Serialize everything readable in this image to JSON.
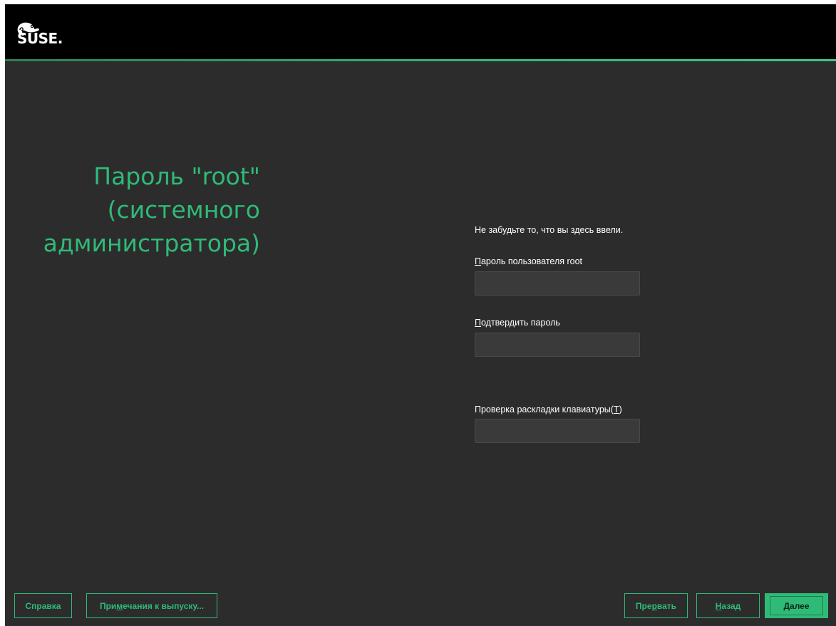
{
  "brand": {
    "logo_text": "SUSE.",
    "accent": "#30ba78"
  },
  "title": "Пароль \"root\"\n(системного\nадминистратора)",
  "hint": "Не забудьте то, что вы здесь ввели.",
  "fields": {
    "root_password": {
      "mnemonic": "П",
      "label_rest": "ароль пользователя root",
      "value": ""
    },
    "confirm_password": {
      "mnemonic": "П",
      "label_rest": "одтвердить пароль",
      "value": ""
    },
    "keyboard_test": {
      "label_pre": "Проверка раскладки клавиатуры(",
      "mnemonic": "T",
      "label_post": ")",
      "value": ""
    }
  },
  "buttons": {
    "help": "Справка",
    "notes_pre": "При",
    "notes_mn": "м",
    "notes_post": "ечания к выпуску...",
    "abort_pre": "Пре",
    "abort_mn": "р",
    "abort_post": "вать",
    "back_mn": "Н",
    "back_post": "азад",
    "next_mn": "Д",
    "next_post": "алее"
  }
}
